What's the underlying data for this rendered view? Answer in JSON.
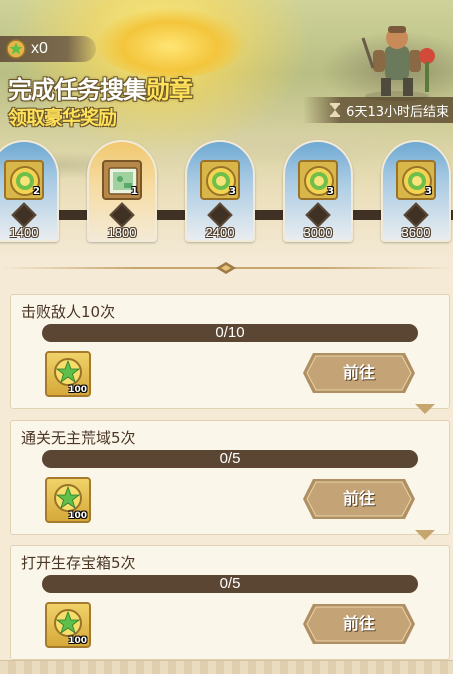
{
  "header": {
    "medal_count": "x0",
    "title_main": "完成任务搜集",
    "title_highlight": "勋章",
    "subtitle": "领取豪华奖励",
    "timer": "6天13小时后结束"
  },
  "milestones": [
    {
      "value": "1400",
      "qty": "2",
      "icon": "medal-coin-icon",
      "style": "blue"
    },
    {
      "value": "1800",
      "qty": "1",
      "icon": "green-card-icon",
      "style": "gold"
    },
    {
      "value": "2400",
      "qty": "3",
      "icon": "medal-coin-icon",
      "style": "blue"
    },
    {
      "value": "3000",
      "qty": "3",
      "icon": "medal-coin-icon",
      "style": "blue"
    },
    {
      "value": "3600",
      "qty": "3",
      "icon": "medal-coin-icon",
      "style": "blue"
    }
  ],
  "tasks": [
    {
      "title": "击败敌人10次",
      "progress_text": "0/10",
      "progress": 0,
      "reward_qty": "100",
      "button": "前往"
    },
    {
      "title": "通关无主荒域5次",
      "progress_text": "0/5",
      "progress": 0,
      "reward_qty": "100",
      "button": "前往"
    },
    {
      "title": "打开生存宝箱5次",
      "progress_text": "0/5",
      "progress": 0,
      "reward_qty": "100",
      "button": "前往"
    }
  ],
  "colors": {
    "accent_gold": "#ffe15a",
    "progress_track": "#5b4533",
    "button": "#b59567"
  }
}
